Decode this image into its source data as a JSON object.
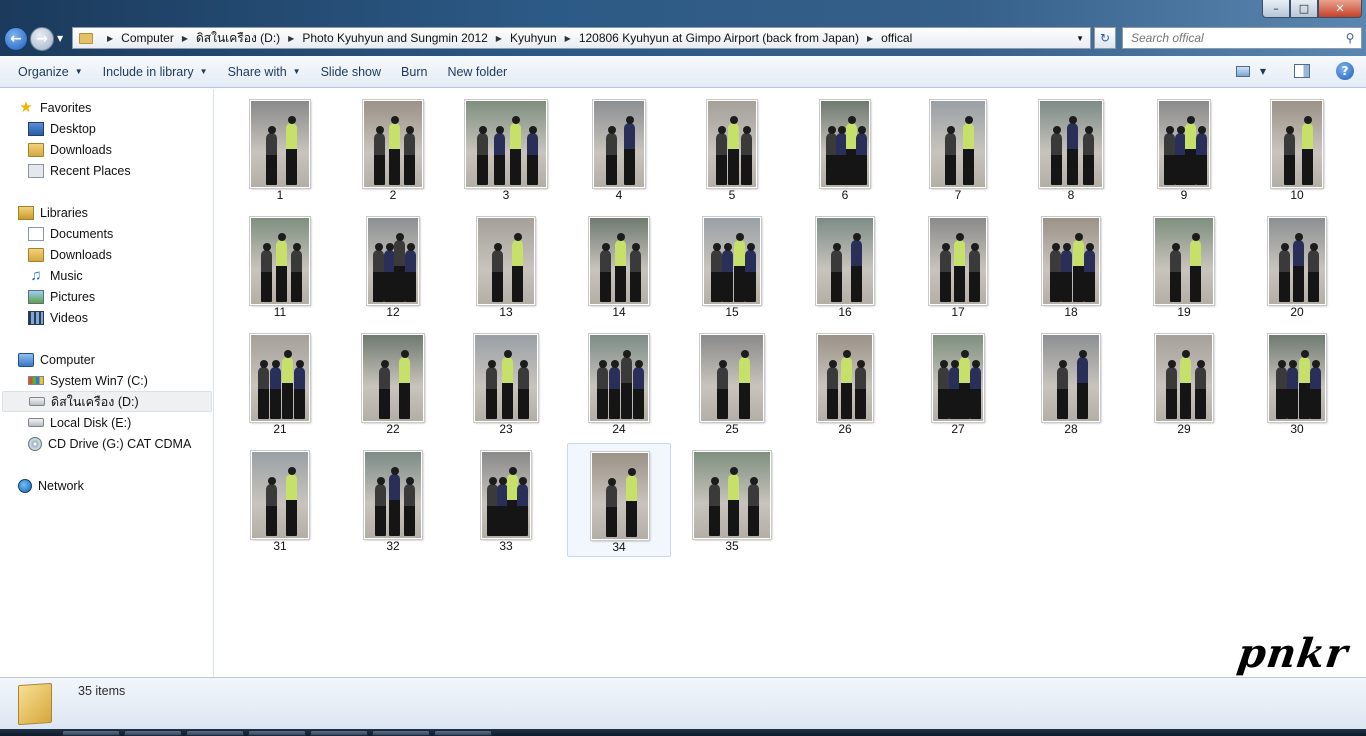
{
  "window": {
    "controls": {
      "minimize": "–",
      "maximize": "□",
      "close": "✕"
    }
  },
  "address_bar": {
    "crumbs": [
      "Computer",
      "ดิสในเครือง (D:)",
      "Photo Kyuhyun and Sungmin 2012",
      "Kyuhyun",
      "120806 Kyuhyun at Gimpo Airport (back from Japan)",
      "offical"
    ]
  },
  "search": {
    "placeholder": "Search offical"
  },
  "toolbar": {
    "organize": "Organize",
    "include_in_library": "Include in library",
    "share_with": "Share with",
    "slide_show": "Slide show",
    "burn": "Burn",
    "new_folder": "New folder",
    "help": "?"
  },
  "navigation": {
    "favorites_label": "Favorites",
    "favorites": [
      "Desktop",
      "Downloads",
      "Recent Places"
    ],
    "libraries_label": "Libraries",
    "libraries": [
      "Documents",
      "Downloads",
      "Music",
      "Pictures",
      "Videos"
    ],
    "computer_label": "Computer",
    "drives": [
      "System Win7 (C:)",
      "ดิสในเครือง (D:)",
      "Local Disk (E:)",
      "CD Drive (G:) CAT CDMA"
    ],
    "network_label": "Network"
  },
  "files": [
    "1",
    "2",
    "3",
    "4",
    "5",
    "6",
    "7",
    "8",
    "9",
    "10",
    "11",
    "12",
    "13",
    "14",
    "15",
    "16",
    "17",
    "18",
    "19",
    "20",
    "21",
    "22",
    "23",
    "24",
    "25",
    "26",
    "27",
    "28",
    "29",
    "30",
    "31",
    "32",
    "33",
    "34",
    "35"
  ],
  "selected_file": "34",
  "watermark": "pnkr",
  "details": {
    "item_count": "35 items"
  },
  "colors": {
    "accent": "#2c5a86",
    "selection": "#c7d9ef",
    "tank_top": "#c6e06a",
    "navy_shirt": "#2a2f5a"
  }
}
